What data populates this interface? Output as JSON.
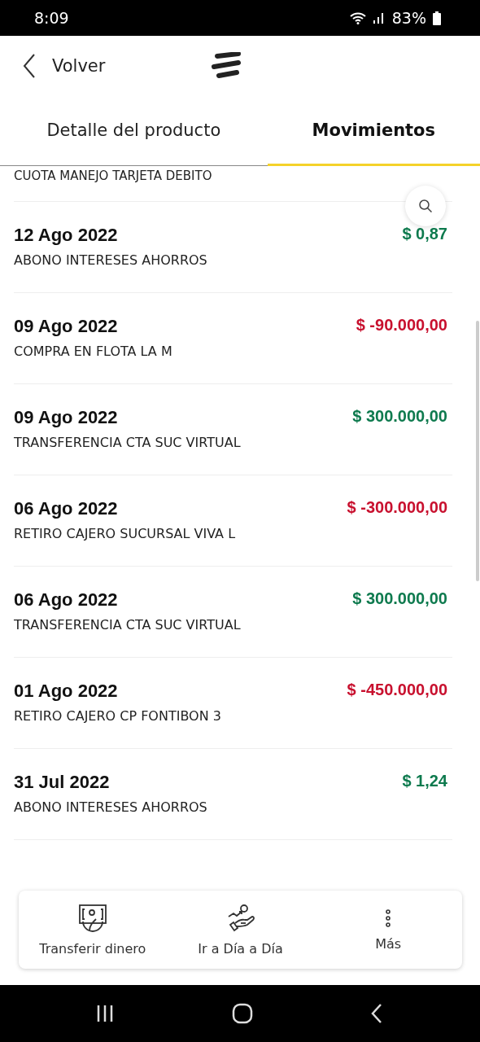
{
  "status_bar": {
    "time": "8:09",
    "battery": "83%"
  },
  "header": {
    "back_label": "Volver"
  },
  "tabs": [
    {
      "label": "Detalle del producto",
      "selected": false
    },
    {
      "label": "Movimientos",
      "selected": true
    }
  ],
  "partial_description": "CUOTA MANEJO TARJETA DEBITO",
  "movements": [
    {
      "date": "12 Ago 2022",
      "description": "ABONO INTERESES AHORROS",
      "amount": "$ 0,87",
      "color": "#0e7a4e"
    },
    {
      "date": "09 Ago 2022",
      "description": "COMPRA EN  FLOTA LA M",
      "amount": "$ -90.000,00",
      "color": "#c8102e"
    },
    {
      "date": "09 Ago 2022",
      "description": "TRANSFERENCIA CTA SUC VIRTUAL",
      "amount": "$ 300.000,00",
      "color": "#0e7a4e"
    },
    {
      "date": "06 Ago 2022",
      "description": "RETIRO CAJERO  SUCURSAL VIVA L",
      "amount": "$ -300.000,00",
      "color": "#c8102e"
    },
    {
      "date": "06 Ago 2022",
      "description": "TRANSFERENCIA CTA SUC VIRTUAL",
      "amount": "$ 300.000,00",
      "color": "#0e7a4e"
    },
    {
      "date": "01 Ago 2022",
      "description": "RETIRO CAJERO  CP FONTIBON 3",
      "amount": "$ -450.000,00",
      "color": "#c8102e"
    },
    {
      "date": "31 Jul 2022",
      "description": "ABONO INTERESES AHORROS",
      "amount": "$ 1,24",
      "color": "#0e7a4e"
    }
  ],
  "actions": [
    {
      "label": "Transferir dinero",
      "kind": "transfer"
    },
    {
      "label": "Ir a Día a Día",
      "kind": "growth"
    },
    {
      "label": "Más",
      "kind": "more"
    }
  ]
}
